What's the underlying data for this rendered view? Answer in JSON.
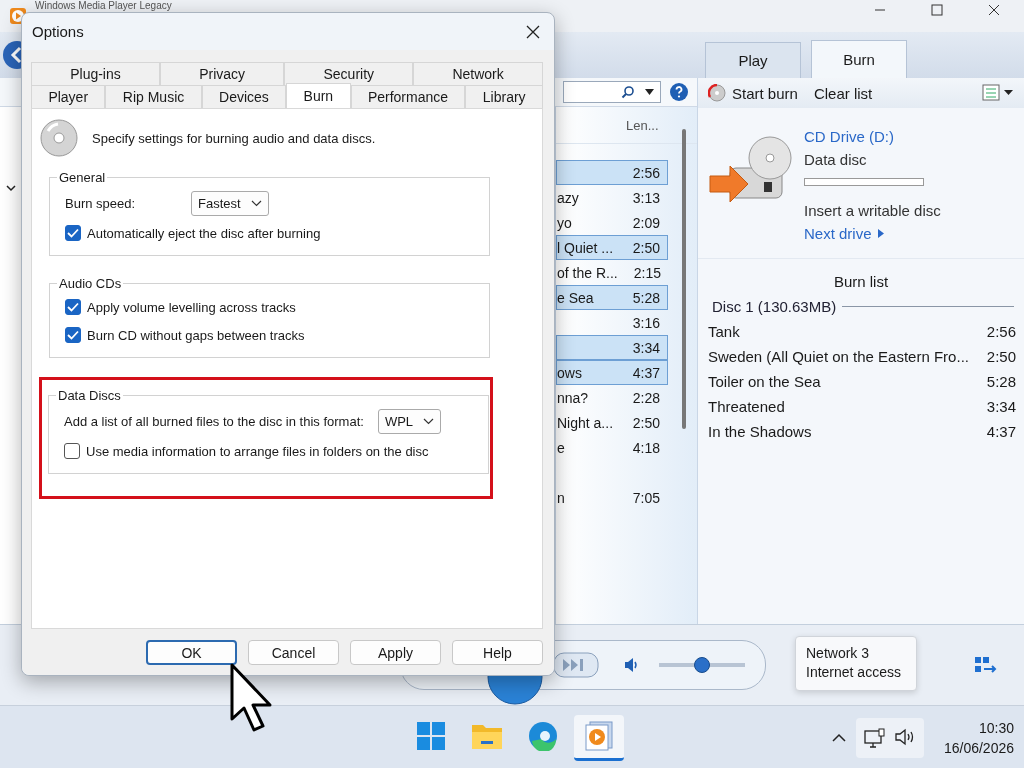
{
  "player_window": {
    "title": "Windows Media Player Legacy",
    "library_list": {
      "column_header": "Len...",
      "rows": [
        {
          "title": "",
          "length": "2:56",
          "selected": true
        },
        {
          "title": "azy",
          "length": "3:13",
          "selected": false
        },
        {
          "title": "yo",
          "length": "2:09",
          "selected": false
        },
        {
          "title": "l Quiet ...",
          "length": "2:50",
          "selected": true
        },
        {
          "title": "of the R...",
          "length": "2:15",
          "selected": false
        },
        {
          "title": "e Sea",
          "length": "5:28",
          "selected": true
        },
        {
          "title": "",
          "length": "3:16",
          "selected": false
        },
        {
          "title": "",
          "length": "3:34",
          "selected": true
        },
        {
          "title": "ows",
          "length": "4:37",
          "selected": true
        },
        {
          "title": "nna?",
          "length": "2:28",
          "selected": false
        },
        {
          "title": "Night a...",
          "length": "2:50",
          "selected": false
        },
        {
          "title": "e",
          "length": "4:18",
          "selected": false
        },
        {
          "selected": false
        },
        {
          "title": "n",
          "length": "7:05",
          "selected": false
        }
      ]
    },
    "tabs": [
      {
        "label": "Play",
        "selected": false
      },
      {
        "label": "Burn",
        "selected": true
      }
    ],
    "burn_toolbar": {
      "start": "Start burn",
      "clear": "Clear list"
    },
    "drive": {
      "name": "CD Drive (D:)",
      "disc_type": "Data disc",
      "status": "Insert a writable disc",
      "next": "Next drive"
    },
    "burn_list": {
      "title": "Burn list",
      "disc": "Disc 1 (130.63MB)",
      "tracks": [
        {
          "title": "Tank",
          "length": "2:56"
        },
        {
          "title": "Sweden (All Quiet on the Eastern Fro...",
          "length": "2:50"
        },
        {
          "title": "Toiler on the Sea",
          "length": "5:28"
        },
        {
          "title": "Threatened",
          "length": "3:34"
        },
        {
          "title": "In the Shadows",
          "length": "4:37"
        }
      ]
    },
    "volume": {
      "level": 0.5
    }
  },
  "tooltip": {
    "lines": [
      "Network 3",
      "Internet access"
    ]
  },
  "dialog": {
    "title": "Options",
    "tab_rows": [
      [
        {
          "label": "Plug-ins",
          "selected": false
        },
        {
          "label": "Privacy",
          "selected": false
        },
        {
          "label": "Security",
          "selected": false
        },
        {
          "label": "Network",
          "selected": false
        }
      ],
      [
        {
          "label": "Player",
          "selected": false
        },
        {
          "label": "Rip Music",
          "selected": false
        },
        {
          "label": "Devices",
          "selected": false
        },
        {
          "label": "Burn",
          "selected": true
        },
        {
          "label": "Performance",
          "selected": false
        },
        {
          "label": "Library",
          "selected": false
        }
      ]
    ],
    "intro": "Specify settings for burning audio and data discs.",
    "groups": [
      {
        "title": "General",
        "highlighted": false,
        "items": [
          {
            "kind": "dropdown",
            "label": "Burn speed:",
            "value": "Fastest"
          },
          {
            "kind": "checkbox",
            "label": "Automatically eject the disc after burning",
            "checked": true
          }
        ]
      },
      {
        "title": "Audio CDs",
        "highlighted": false,
        "items": [
          {
            "kind": "checkbox",
            "label": "Apply volume levelling across tracks",
            "checked": true
          },
          {
            "kind": "checkbox",
            "label": "Burn CD without gaps between tracks",
            "checked": true
          }
        ]
      },
      {
        "title": "Data Discs",
        "highlighted": true,
        "items": [
          {
            "kind": "dropdown",
            "label": "Add a list of all burned files to the disc in this format:",
            "value": "WPL"
          },
          {
            "kind": "checkbox",
            "label": "Use media information to arrange files in folders on the disc",
            "checked": false
          }
        ]
      }
    ],
    "buttons": [
      {
        "label": "OK",
        "default": true
      },
      {
        "label": "Cancel",
        "default": false
      },
      {
        "label": "Apply",
        "default": false
      },
      {
        "label": "Help",
        "default": false
      }
    ]
  },
  "taskbar": {
    "apps": [
      {
        "kind": "start",
        "selected": false
      },
      {
        "kind": "files",
        "selected": false
      },
      {
        "kind": "browser",
        "selected": false
      },
      {
        "kind": "player",
        "selected": true
      }
    ],
    "time": "10:30",
    "date": "16/06/2026"
  }
}
